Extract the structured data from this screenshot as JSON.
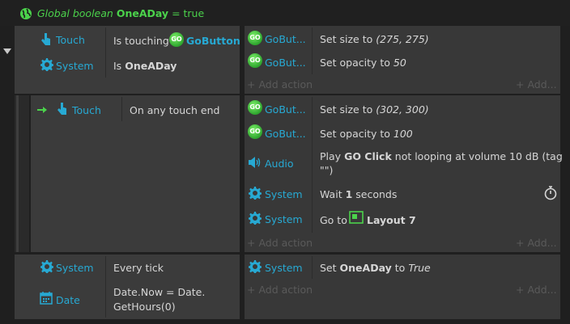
{
  "header": {
    "prefix": "Global boolean",
    "var_name": "OneADay",
    "suffix": "= true"
  },
  "block1": {
    "conditions": [
      {
        "obj": "Touch",
        "pre": "Is touching",
        "target": "GoButton",
        "post": ""
      },
      {
        "obj": "System",
        "pre": "Is",
        "bold": "OneADay"
      }
    ],
    "actions": [
      {
        "obj": "GoBut...",
        "pre": "Set size to",
        "ital": "(275, 275)"
      },
      {
        "obj": "GoBut...",
        "pre": "Set opacity to",
        "ital": "50"
      }
    ],
    "add_action": "Add action",
    "add_more": "Add..."
  },
  "block2": {
    "conditions": [
      {
        "obj": "Touch",
        "text": "On any touch end"
      }
    ],
    "actions": [
      {
        "obj": "GoBut...",
        "pre": "Set size to",
        "ital": "(302, 300)"
      },
      {
        "obj": "GoBut...",
        "pre": "Set opacity to",
        "ital": "100"
      },
      {
        "obj": "Audio",
        "pre": "Play",
        "bold": "GO Click",
        "post": "not looping at volume 10 dB (tag",
        "line2": "\"\")"
      },
      {
        "obj": "System",
        "pre": "Wait",
        "bold": "1",
        "post": "seconds"
      },
      {
        "obj": "System",
        "pre": "Go to",
        "bold": "Layout 7"
      }
    ],
    "add_action": "Add action",
    "add_more": "Add..."
  },
  "block3": {
    "conditions": [
      {
        "obj": "System",
        "text": "Every tick"
      },
      {
        "obj": "Date",
        "line1": "Date.Now = Date.",
        "line2": "GetHours(0)"
      }
    ],
    "actions": [
      {
        "obj": "System",
        "pre": "Set",
        "bold": "OneADay",
        "mid": "to",
        "ital": "True"
      }
    ],
    "add_action": "Add action",
    "add_more": "Add..."
  },
  "colors": {
    "header_green": "#4bd24b",
    "object_blue": "#27a9d3",
    "row_bg": "#383838",
    "add_muted": "#5a5a5a"
  }
}
